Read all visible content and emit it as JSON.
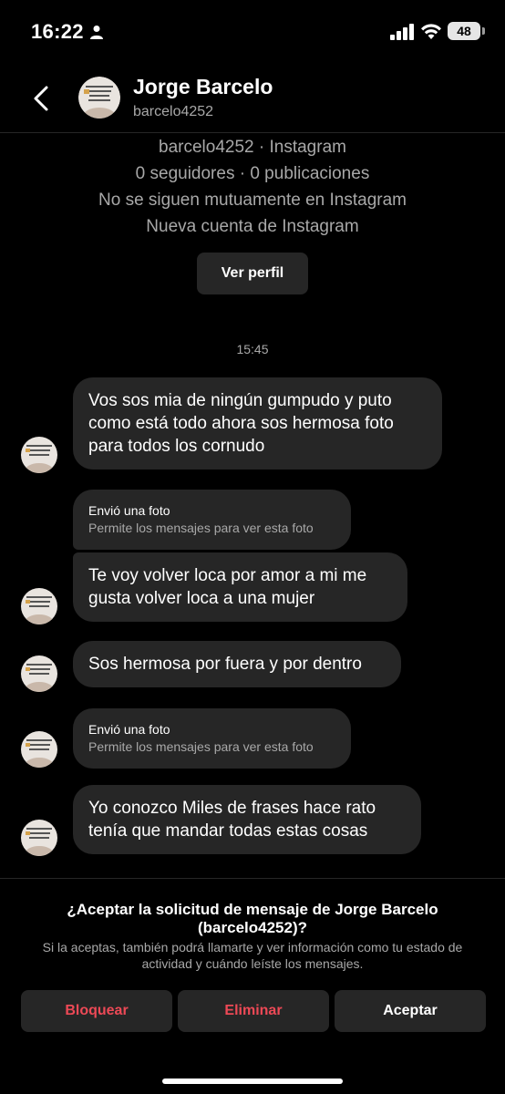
{
  "status_bar": {
    "time": "16:22",
    "battery": "48"
  },
  "header": {
    "name": "Jorge Barcelo",
    "username": "barcelo4252"
  },
  "profile_info": {
    "lines": [
      "barcelo4252 · Instagram",
      "0 seguidores · 0 publicaciones",
      "No se siguen mutuamente en Instagram",
      "Nueva cuenta de Instagram"
    ],
    "view_profile_label": "Ver perfil"
  },
  "chat": {
    "timestamp": "15:45",
    "messages": [
      {
        "type": "text",
        "text": "Vos sos mia de ningún gumpudo y puto como está todo ahora sos hermosa foto para todos los cornudo"
      },
      {
        "type": "photo",
        "title": "Envió una foto",
        "subtitle": "Permite los mensajes para ver esta foto"
      },
      {
        "type": "text",
        "text": "Te voy volver loca por amor a mi me gusta volver loca a una mujer"
      },
      {
        "type": "text",
        "text": "Sos hermosa por fuera y por dentro"
      },
      {
        "type": "photo",
        "title": "Envió una foto",
        "subtitle": "Permite los mensajes para ver esta foto"
      },
      {
        "type": "text",
        "text": "Yo conozco Miles de frases hace rato tenía que mandar todas estas cosas"
      }
    ]
  },
  "request": {
    "title": "¿Aceptar la solicitud de mensaje de Jorge Barcelo (barcelo4252)?",
    "description": "Si la aceptas, también podrá llamarte y ver información como tu estado de actividad y cuándo leíste los mensajes.",
    "block_label": "Bloquear",
    "delete_label": "Eliminar",
    "accept_label": "Aceptar"
  },
  "colors": {
    "background": "#000000",
    "bubble": "#262626",
    "secondary_text": "#a8a8a8",
    "danger": "#ed4956"
  }
}
